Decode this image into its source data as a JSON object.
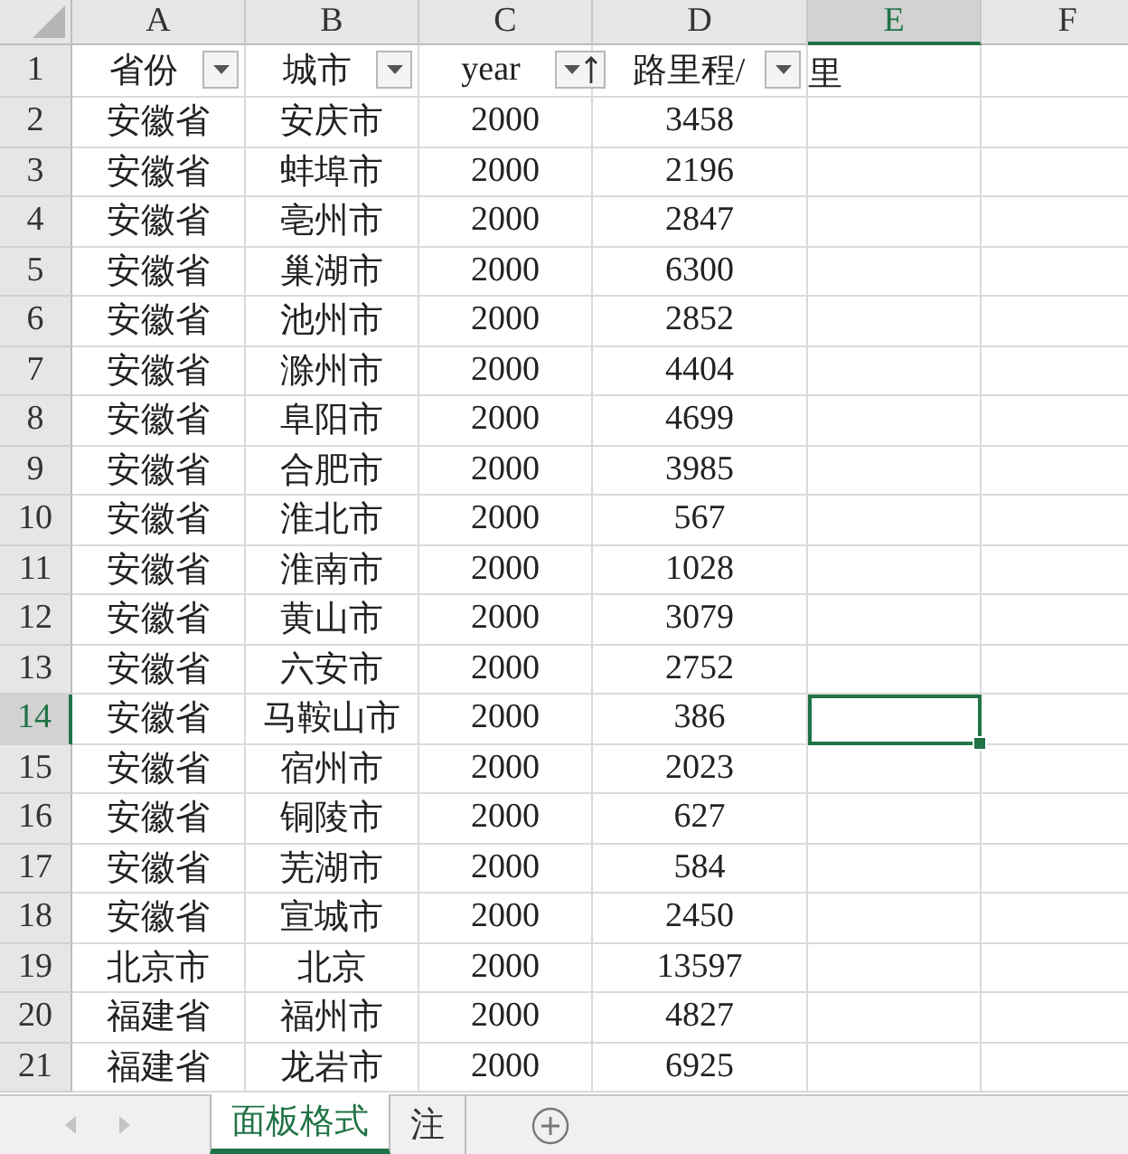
{
  "columns": [
    {
      "label": "A",
      "selected": false
    },
    {
      "label": "B",
      "selected": false
    },
    {
      "label": "C",
      "selected": false
    },
    {
      "label": "D",
      "selected": false
    },
    {
      "label": "E",
      "selected": true
    },
    {
      "label": "F",
      "selected": false
    }
  ],
  "header_row": {
    "number": "1",
    "selected": false,
    "cells": [
      {
        "text": "省份",
        "kind": "dropdown"
      },
      {
        "text": "城市",
        "kind": "dropdown"
      },
      {
        "text": "year",
        "kind": "sorted"
      },
      {
        "text": "路里程/",
        "text_after": "里",
        "kind": "dropdown"
      }
    ]
  },
  "rows": [
    {
      "number": "2",
      "selected": false,
      "cells": [
        "安徽省",
        "安庆市",
        "2000",
        "3458"
      ]
    },
    {
      "number": "3",
      "selected": false,
      "cells": [
        "安徽省",
        "蚌埠市",
        "2000",
        "2196"
      ]
    },
    {
      "number": "4",
      "selected": false,
      "cells": [
        "安徽省",
        "亳州市",
        "2000",
        "2847"
      ]
    },
    {
      "number": "5",
      "selected": false,
      "cells": [
        "安徽省",
        "巢湖市",
        "2000",
        "6300"
      ]
    },
    {
      "number": "6",
      "selected": false,
      "cells": [
        "安徽省",
        "池州市",
        "2000",
        "2852"
      ]
    },
    {
      "number": "7",
      "selected": false,
      "cells": [
        "安徽省",
        "滁州市",
        "2000",
        "4404"
      ]
    },
    {
      "number": "8",
      "selected": false,
      "cells": [
        "安徽省",
        "阜阳市",
        "2000",
        "4699"
      ]
    },
    {
      "number": "9",
      "selected": false,
      "cells": [
        "安徽省",
        "合肥市",
        "2000",
        "3985"
      ]
    },
    {
      "number": "10",
      "selected": false,
      "cells": [
        "安徽省",
        "淮北市",
        "2000",
        "567"
      ]
    },
    {
      "number": "11",
      "selected": false,
      "cells": [
        "安徽省",
        "淮南市",
        "2000",
        "1028"
      ]
    },
    {
      "number": "12",
      "selected": false,
      "cells": [
        "安徽省",
        "黄山市",
        "2000",
        "3079"
      ]
    },
    {
      "number": "13",
      "selected": false,
      "cells": [
        "安徽省",
        "六安市",
        "2000",
        "2752"
      ]
    },
    {
      "number": "14",
      "selected": true,
      "cells": [
        "安徽省",
        "马鞍山市",
        "2000",
        "386"
      ]
    },
    {
      "number": "15",
      "selected": false,
      "cells": [
        "安徽省",
        "宿州市",
        "2000",
        "2023"
      ]
    },
    {
      "number": "16",
      "selected": false,
      "cells": [
        "安徽省",
        "铜陵市",
        "2000",
        "627"
      ]
    },
    {
      "number": "17",
      "selected": false,
      "cells": [
        "安徽省",
        "芜湖市",
        "2000",
        "584"
      ]
    },
    {
      "number": "18",
      "selected": false,
      "cells": [
        "安徽省",
        "宣城市",
        "2000",
        "2450"
      ]
    },
    {
      "number": "19",
      "selected": false,
      "cells": [
        "北京市",
        "北京",
        "2000",
        "13597"
      ]
    },
    {
      "number": "20",
      "selected": false,
      "cells": [
        "福建省",
        "福州市",
        "2000",
        "4827"
      ]
    },
    {
      "number": "21",
      "selected": false,
      "cells": [
        "福建省",
        "龙岩市",
        "2000",
        "6925"
      ]
    }
  ],
  "sheet_tabs": [
    {
      "label": "面板格式",
      "selected": true
    },
    {
      "label": "注",
      "selected": false
    }
  ]
}
